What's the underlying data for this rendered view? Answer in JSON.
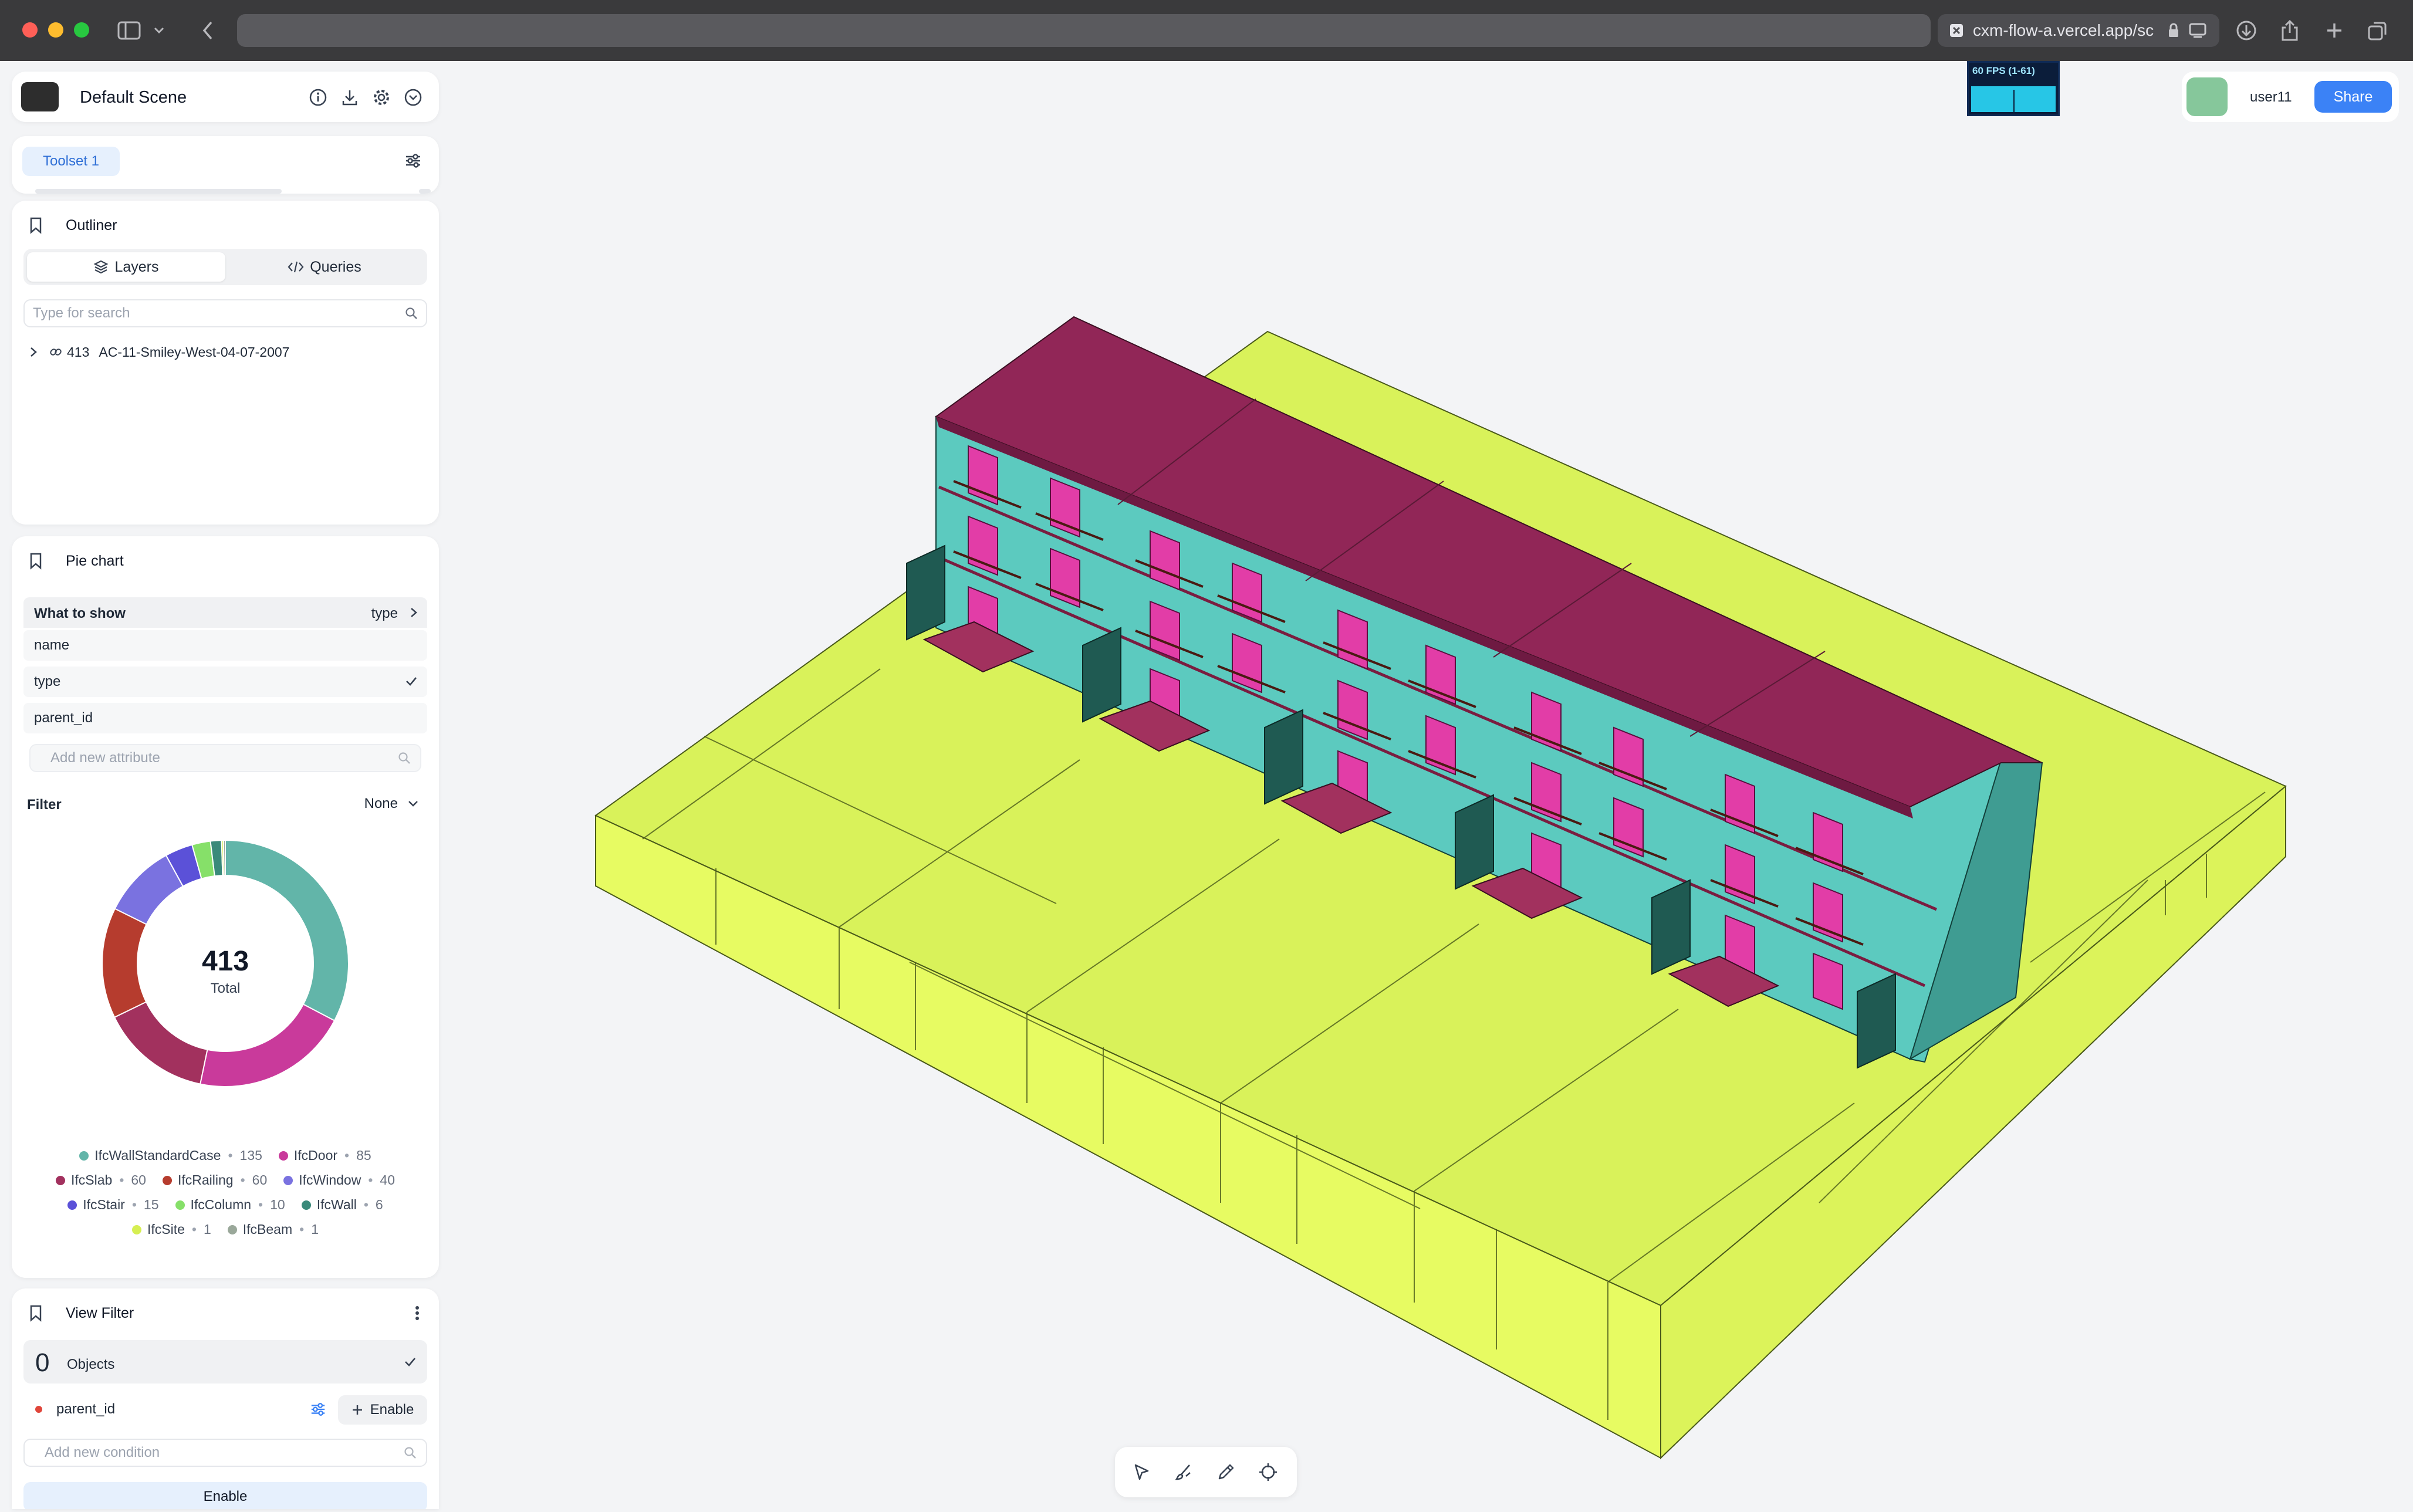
{
  "browser": {
    "tab_title": "cxm-flow-a.vercel.app/sc",
    "traffic_lights": [
      "#ff5f57",
      "#febc2e",
      "#28c840"
    ]
  },
  "header": {
    "scene_title": "Default Scene",
    "icons": [
      "info-icon",
      "download-icon",
      "gear-icon",
      "chevron-circle-icon"
    ]
  },
  "toolset": {
    "tab_label": "Toolset 1"
  },
  "outliner": {
    "title": "Outliner",
    "tabs": [
      {
        "label": "Layers",
        "active": true
      },
      {
        "label": "Queries",
        "active": false
      }
    ],
    "search_placeholder": "Type for search",
    "tree": [
      {
        "count": "413",
        "label": "AC-11-Smiley-West-04-07-2007"
      }
    ]
  },
  "pie_panel": {
    "title": "Pie chart",
    "what_to_show_label": "What to show",
    "what_to_show_value": "type",
    "attributes": [
      "name",
      "type",
      "parent_id"
    ],
    "selected_attribute": "type",
    "add_attribute_placeholder": "Add new attribute",
    "filter_label": "Filter",
    "filter_value": "None"
  },
  "chart_data": {
    "type": "pie",
    "center_value": "413",
    "center_label": "Total",
    "slices": [
      {
        "label": "IfcWallStandardCase",
        "value": 135,
        "color": "#62b5a9"
      },
      {
        "label": "IfcDoor",
        "value": 85,
        "color": "#c93a9b"
      },
      {
        "label": "IfcSlab",
        "value": 60,
        "color": "#a2315e"
      },
      {
        "label": "IfcRailing",
        "value": 60,
        "color": "#b63c2e"
      },
      {
        "label": "IfcWindow",
        "value": 40,
        "color": "#7a72e0"
      },
      {
        "label": "IfcStair",
        "value": 15,
        "color": "#5b51d8"
      },
      {
        "label": "IfcColumn",
        "value": 10,
        "color": "#86e069"
      },
      {
        "label": "IfcWall",
        "value": 6,
        "color": "#3a8a7a"
      },
      {
        "label": "IfcSite",
        "value": 1,
        "color": "#d6ef52"
      },
      {
        "label": "IfcBeam",
        "value": 1,
        "color": "#9aa89a"
      }
    ]
  },
  "view_filter": {
    "title": "View Filter",
    "count": "0",
    "count_label": "Objects",
    "condition_label": "parent_id",
    "condition_dot_color": "#e0453a",
    "enable_label": "Enable",
    "add_condition_placeholder": "Add new condition",
    "bottom_button": "Enable"
  },
  "fps": {
    "label": "60 FPS (1-61)"
  },
  "user": {
    "name": "user11",
    "avatar_color": "#86c79b",
    "share_label": "Share"
  },
  "toolbar": {
    "tools": [
      "pointer-icon",
      "brush-select-icon",
      "pencil-icon",
      "target-icon"
    ]
  },
  "colors": {
    "roof": "#912657",
    "wall": "#5ccabf",
    "door": "#e23da7",
    "site": "#d9f25a",
    "accent": "#3b82f6"
  }
}
